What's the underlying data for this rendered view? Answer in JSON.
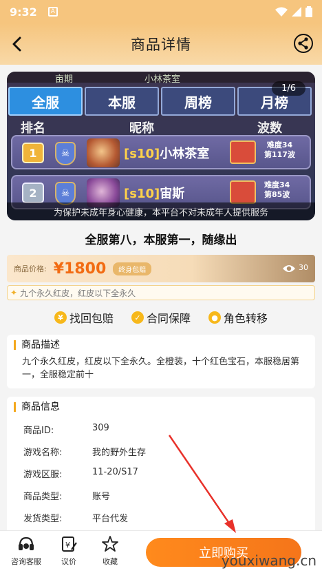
{
  "status_bar": {
    "time": "9:32",
    "sim": "A"
  },
  "nav": {
    "title": "商品详情"
  },
  "gallery": {
    "top_cut": [
      "亩期",
      "小林茶室"
    ],
    "tabs": [
      "全服",
      "本服",
      "周榜",
      "月榜"
    ],
    "header": {
      "rank": "排名",
      "nickname": "昵称",
      "waves": "波数"
    },
    "rows": [
      {
        "rank": "1",
        "server_tag": "[s10]",
        "name": "小林茶室",
        "difficulty": "难度34",
        "wave": "第117波"
      },
      {
        "rank": "2",
        "server_tag": "[s10]",
        "name": "宙斯",
        "difficulty": "难度34",
        "wave": "第85波"
      }
    ],
    "counter": "1/6",
    "caption": "为保护未成年身心健康，本平台不对未成年人提供服务"
  },
  "headline": "全服第八，本服第一，随缘出",
  "price": {
    "label": "商品价格:",
    "value": "¥1800",
    "pill": "终身包赔",
    "views": "30"
  },
  "tagline": "九个永久红皮，红皮以下全永久",
  "guarantees": [
    "找回包赔",
    "合同保障",
    "角色转移"
  ],
  "description": {
    "title": "商品描述",
    "text": "九个永久红皮，红皮以下全永久。全橙装，十个红色宝石，本服稳居第一，全服稳定前十"
  },
  "info": {
    "title": "商品信息",
    "rows": [
      {
        "key": "商品ID:",
        "value": "309"
      },
      {
        "key": "游戏名称:",
        "value": "我的野外生存"
      },
      {
        "key": "游戏区服:",
        "value": "11-20/S17"
      },
      {
        "key": "商品类型:",
        "value": "账号"
      },
      {
        "key": "发货类型:",
        "value": "平台代发"
      }
    ]
  },
  "bottom": {
    "service": "咨询客服",
    "bargain": "议价",
    "favorite": "收藏",
    "buy": "立即购买"
  },
  "watermark": "youxiwang.cn",
  "colors": {
    "accent": "#f5751a",
    "header": "#f6c57e"
  }
}
